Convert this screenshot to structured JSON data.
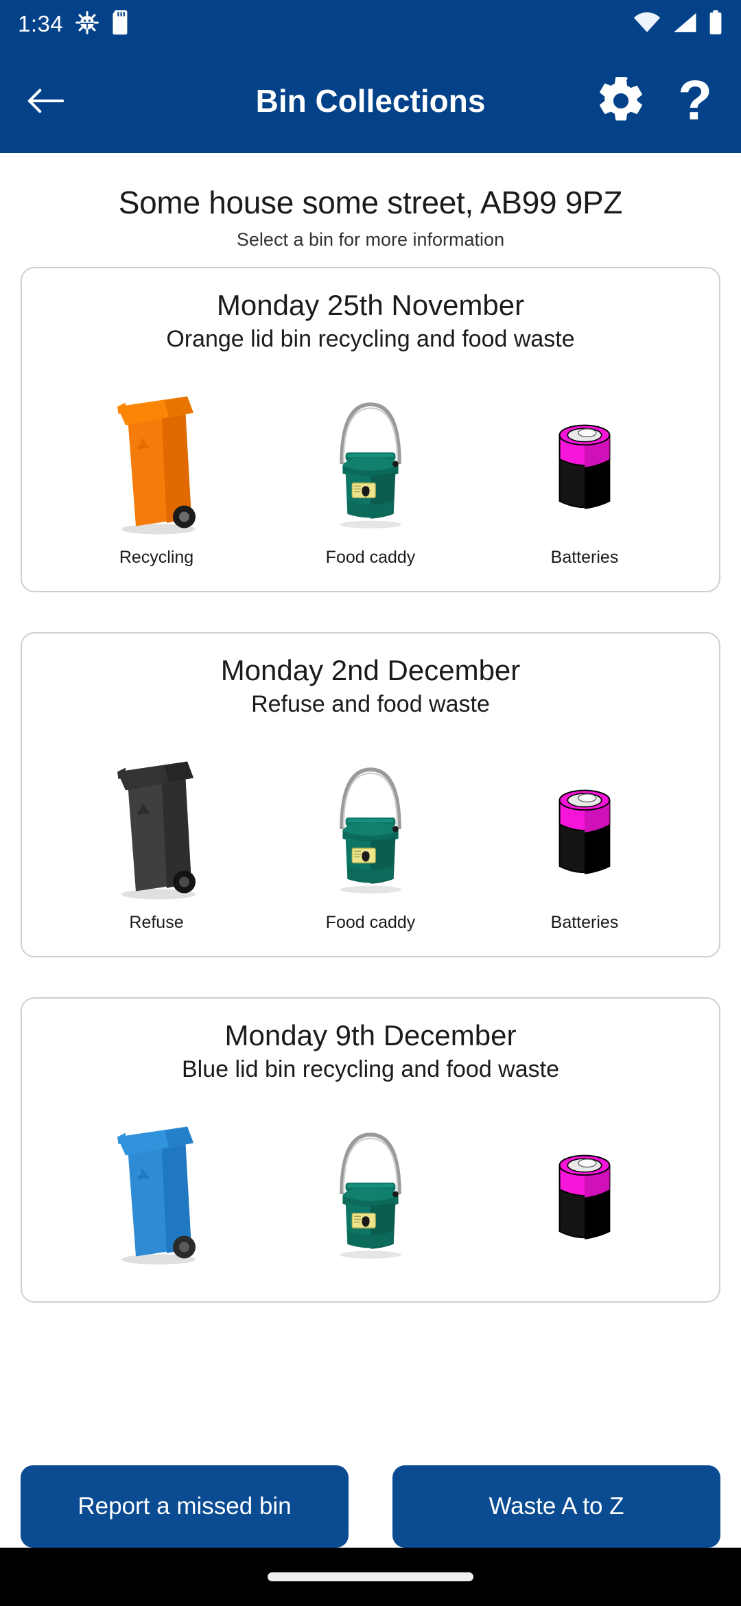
{
  "status_bar": {
    "clock": "1:34",
    "icons": [
      "android-debug-icon",
      "sd-card-icon",
      "wifi-icon",
      "cellular-signal-icon",
      "battery-icon"
    ]
  },
  "app_bar": {
    "title": "Bin Collections",
    "back_icon": "back-arrow-icon",
    "settings_icon": "gear-icon",
    "help_icon": "question-mark-icon",
    "background_color": "#034289"
  },
  "header": {
    "address": "Some house some street, AB99 9PZ",
    "instruction": "Select a bin for more information"
  },
  "collections": [
    {
      "date": "Monday 25th November",
      "description": "Orange lid bin recycling and food waste",
      "bins": [
        {
          "label": "Recycling",
          "type": "wheelie-bin",
          "color": "#F57C0A",
          "lid_color": "#FB8605",
          "icon": "orange-recycling-bin-icon"
        },
        {
          "label": "Food caddy",
          "type": "caddy",
          "color": "#0E7565",
          "lid_color": "#12806F",
          "icon": "green-food-caddy-icon"
        },
        {
          "label": "Batteries",
          "type": "battery",
          "color": "#141414",
          "lid_color": "#F615D8",
          "icon": "battery-icon"
        }
      ]
    },
    {
      "date": "Monday 2nd December",
      "description": "Refuse and food waste",
      "bins": [
        {
          "label": "Refuse",
          "type": "wheelie-bin",
          "color": "#3F3F3F",
          "lid_color": "#333333",
          "icon": "grey-refuse-bin-icon"
        },
        {
          "label": "Food caddy",
          "type": "caddy",
          "color": "#0E7565",
          "lid_color": "#12806F",
          "icon": "green-food-caddy-icon"
        },
        {
          "label": "Batteries",
          "type": "battery",
          "color": "#141414",
          "lid_color": "#F615D8",
          "icon": "battery-icon"
        }
      ]
    },
    {
      "date": "Monday 9th December",
      "description": "Blue lid bin recycling and food waste",
      "bins": [
        {
          "label": "",
          "type": "wheelie-bin",
          "color": "#2E8BD4",
          "lid_color": "#2E8BD4",
          "icon": "blue-recycling-bin-icon"
        },
        {
          "label": "",
          "type": "caddy",
          "color": "#0E7565",
          "lid_color": "#12806F",
          "icon": "green-food-caddy-icon"
        },
        {
          "label": "",
          "type": "battery",
          "color": "#141414",
          "lid_color": "#F615D8",
          "icon": "battery-icon"
        }
      ]
    }
  ],
  "footer": {
    "report_button": "Report a missed bin",
    "waste_az_button": "Waste A to Z",
    "button_color": "#0a4b92"
  }
}
